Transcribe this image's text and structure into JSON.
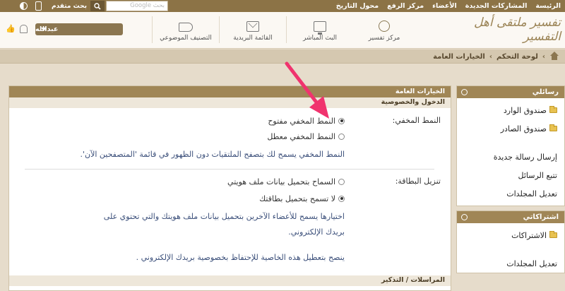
{
  "topbar": {
    "nav": [
      "الرئيسة",
      "المشاركات الجديدة",
      "الأعضاء",
      "مركز الرفع",
      "محول التاريخ"
    ],
    "search_placeholder": "بحث Google",
    "advanced_search": "بحث متقدم"
  },
  "header": {
    "logo_text": "تفسير ملتقى أهل التفسير",
    "nav": [
      {
        "label": "مركز تفسير",
        "icon": "globe-icon"
      },
      {
        "label": "البث المباشر",
        "icon": "monitor-icon"
      },
      {
        "label": "القائمة البريدية",
        "icon": "mail-icon"
      },
      {
        "label": "التصنيف الموضوعي",
        "icon": "tag-icon"
      }
    ],
    "username": "عبدالله"
  },
  "breadcrumb": [
    "لوحة التحكم",
    "الخيارات العامة"
  ],
  "panel": {
    "title": "الخيارات العامة",
    "section1": "الدخول والخصوصية",
    "invisible": {
      "label": "النمط المخفي:",
      "options": [
        "النمط المخفي مفتوح",
        "النمط المخفي معطل"
      ],
      "selected": 0,
      "desc": "النمط المخفي يسمح لك بتصفح الملتقيات دون الظهور في قائمة 'المتصفحين الآن'."
    },
    "vcard": {
      "label": "تنزيل البطاقة:",
      "options": [
        "السماح بتحميل بيانات ملف هويتي",
        "لا تسمح بتحميل بطاقتك"
      ],
      "selected": 1,
      "desc1a": "اختيارها يسمح للأعضاء الآخرين بتحميل بيانات ملف هويتك والتي تحتوي على",
      "desc1b": "بريدك الإلكتروني.",
      "desc2": "ينصح بتعطيل هذه الخاصية للإحتفاظ بخصوصية بريدك الإلكتروني ."
    },
    "section2": "المراسلات / التذكير"
  },
  "side": {
    "messages_title": "رسائلي",
    "messages_items": [
      "صندوق الوارد",
      "صندوق الصادر",
      "إرسال رسالة جديدة",
      "تتبع الرسائل",
      "تعديل المجلدات"
    ],
    "subs_title": "اشتراكاتي",
    "subs_items": [
      "الاشتراكات",
      "تعديل المجلدات"
    ]
  },
  "colors": {
    "topbar": "#8c7346",
    "panel_head": "#a08656",
    "accent_arrow": "#f0336e",
    "desc_text": "#3b4f7a"
  }
}
